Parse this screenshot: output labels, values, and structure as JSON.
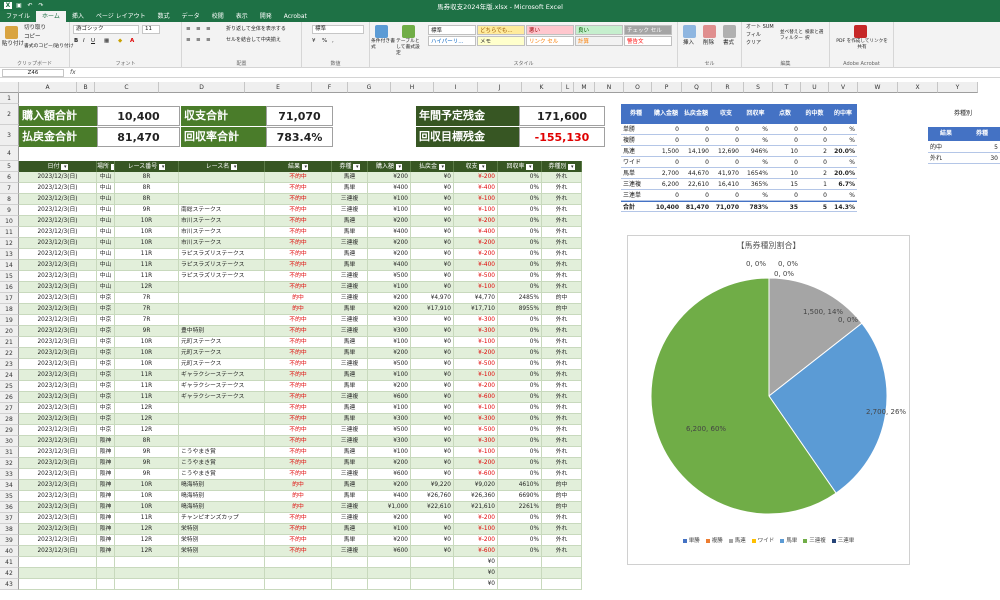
{
  "app": {
    "title": "馬券収支2024年版.xlsx - Microsoft Excel"
  },
  "tabs": [
    "ファイル",
    "ホーム",
    "挿入",
    "ページ レイアウト",
    "数式",
    "データ",
    "校閲",
    "表示",
    "開発",
    "Acrobat"
  ],
  "ribbon": {
    "clipboard": {
      "label": "クリップボード",
      "paste": "貼り付け",
      "cut": "切り取り",
      "copy": "コピー",
      "format_painter": "書式のコピー/貼り付け"
    },
    "font": {
      "label": "フォント",
      "name": "游ゴシック",
      "size": "11"
    },
    "alignment": {
      "label": "配置",
      "wrap": "折り返して全体を表示する",
      "merge": "セルを結合して中央揃え"
    },
    "number": {
      "label": "数値",
      "format": "標準"
    },
    "styles": {
      "label": "スタイル",
      "conditional": "条件付き書式",
      "table": "テーブルとして書式設定",
      "cells": [
        {
          "text": "標準",
          "bg": "#ffffff",
          "fg": "#222222"
        },
        {
          "text": "どちらでも...",
          "bg": "#ffeb9c",
          "fg": "#9c5700"
        },
        {
          "text": "悪い",
          "bg": "#ffc7ce",
          "fg": "#9c0006"
        },
        {
          "text": "良い",
          "bg": "#c6efce",
          "fg": "#006100"
        },
        {
          "text": "チェック セル",
          "bg": "#a5a5a5",
          "fg": "#ffffff"
        },
        {
          "text": "ハイパーリ...",
          "bg": "#ffffff",
          "fg": "#0563c1"
        },
        {
          "text": "メモ",
          "bg": "#ffffcc",
          "fg": "#222222"
        },
        {
          "text": "リンク セル",
          "bg": "#ffffff",
          "fg": "#fa7d00"
        },
        {
          "text": "計算",
          "bg": "#f2f2f2",
          "fg": "#fa7d00"
        },
        {
          "text": "警告文",
          "bg": "#ffffff",
          "fg": "#ff0000"
        }
      ]
    },
    "cells": {
      "label": "セル",
      "insert": "挿入",
      "delete": "削除",
      "format": "書式"
    },
    "editing": {
      "label": "編集",
      "autosum": "オート SUM",
      "fill": "フィル",
      "clear": "クリア",
      "sort": "並べ替えとフィルター",
      "find": "検索と選択"
    },
    "acrobat": {
      "label": "Adobe Acrobat",
      "pdf": "PDF を作成してリンクを共有"
    }
  },
  "formula_bar": {
    "name_box": "Z46",
    "fx": "fx"
  },
  "columns": [
    "A",
    "B",
    "C",
    "D",
    "E",
    "F",
    "G",
    "H",
    "I",
    "J",
    "K",
    "L",
    "M",
    "N",
    "O",
    "P",
    "Q",
    "R",
    "S",
    "T",
    "U",
    "V",
    "W",
    "X",
    "Y"
  ],
  "rows": [
    "1",
    "2",
    "3",
    "4",
    "5",
    "6",
    "7",
    "8",
    "9",
    "10",
    "11",
    "12",
    "13",
    "14",
    "15",
    "16",
    "17",
    "18",
    "19",
    "20",
    "21",
    "22",
    "23",
    "24",
    "25",
    "26",
    "27",
    "28",
    "29",
    "30",
    "31",
    "32",
    "33",
    "34",
    "35",
    "36",
    "37",
    "38",
    "39",
    "40",
    "41",
    "42",
    "43"
  ],
  "summary": {
    "purchase_label": "購入額合計",
    "purchase_value": "10,400",
    "balance_label": "収支合計",
    "balance_value": "71,070",
    "payout_label": "払戻金合計",
    "payout_value": "81,470",
    "return_label": "回収率合計",
    "return_value": "783.4%",
    "annual_label": "年間予定残金",
    "annual_value": "171,600",
    "target_label": "回収目標残金",
    "target_value": "-155,130"
  },
  "table": {
    "headers": [
      "日付",
      "場所",
      "レース番号",
      "レース名",
      "結果",
      "券種",
      "購入額",
      "払戻金",
      "収支",
      "回収率",
      "券種別"
    ],
    "rows": [
      [
        "2023/12/3(日)",
        "中山",
        "8R",
        "",
        "不的中",
        "馬連",
        "¥200",
        "¥0",
        "¥-200",
        "0%",
        "外れ"
      ],
      [
        "2023/12/3(日)",
        "中山",
        "8R",
        "",
        "不的中",
        "馬単",
        "¥400",
        "¥0",
        "¥-400",
        "0%",
        "外れ"
      ],
      [
        "2023/12/3(日)",
        "中山",
        "8R",
        "",
        "不的中",
        "三連複",
        "¥100",
        "¥0",
        "¥-100",
        "0%",
        "外れ"
      ],
      [
        "2023/12/3(日)",
        "中山",
        "9R",
        "南総ステークス",
        "不的中",
        "三連複",
        "¥100",
        "¥0",
        "¥-100",
        "0%",
        "外れ"
      ],
      [
        "2023/12/3(日)",
        "中山",
        "10R",
        "市川ステークス",
        "不的中",
        "馬連",
        "¥200",
        "¥0",
        "¥-200",
        "0%",
        "外れ"
      ],
      [
        "2023/12/3(日)",
        "中山",
        "10R",
        "市川ステークス",
        "不的中",
        "馬単",
        "¥400",
        "¥0",
        "¥-400",
        "0%",
        "外れ"
      ],
      [
        "2023/12/3(日)",
        "中山",
        "10R",
        "市川ステークス",
        "不的中",
        "三連複",
        "¥200",
        "¥0",
        "¥-200",
        "0%",
        "外れ"
      ],
      [
        "2023/12/3(日)",
        "中山",
        "11R",
        "ラピスラズリステークス",
        "不的中",
        "馬連",
        "¥200",
        "¥0",
        "¥-200",
        "0%",
        "外れ"
      ],
      [
        "2023/12/3(日)",
        "中山",
        "11R",
        "ラピスラズリステークス",
        "不的中",
        "馬単",
        "¥400",
        "¥0",
        "¥-400",
        "0%",
        "外れ"
      ],
      [
        "2023/12/3(日)",
        "中山",
        "11R",
        "ラピスラズリステークス",
        "不的中",
        "三連複",
        "¥500",
        "¥0",
        "¥-500",
        "0%",
        "外れ"
      ],
      [
        "2023/12/3(日)",
        "中山",
        "12R",
        "",
        "不的中",
        "三連複",
        "¥100",
        "¥0",
        "¥-100",
        "0%",
        "外れ"
      ],
      [
        "2023/12/3(日)",
        "中京",
        "7R",
        "",
        "的中",
        "三連複",
        "¥200",
        "¥4,970",
        "¥4,770",
        "2485%",
        "的中"
      ],
      [
        "2023/12/3(日)",
        "中京",
        "7R",
        "",
        "的中",
        "馬単",
        "¥200",
        "¥17,910",
        "¥17,710",
        "8955%",
        "的中"
      ],
      [
        "2023/12/3(日)",
        "中京",
        "7R",
        "",
        "不的中",
        "三連複",
        "¥300",
        "¥0",
        "¥-300",
        "0%",
        "外れ"
      ],
      [
        "2023/12/3(日)",
        "中京",
        "9R",
        "豊中特別",
        "不的中",
        "三連複",
        "¥300",
        "¥0",
        "¥-300",
        "0%",
        "外れ"
      ],
      [
        "2023/12/3(日)",
        "中京",
        "10R",
        "元町ステークス",
        "不的中",
        "馬連",
        "¥100",
        "¥0",
        "¥-100",
        "0%",
        "外れ"
      ],
      [
        "2023/12/3(日)",
        "中京",
        "10R",
        "元町ステークス",
        "不的中",
        "馬単",
        "¥200",
        "¥0",
        "¥-200",
        "0%",
        "外れ"
      ],
      [
        "2023/12/3(日)",
        "中京",
        "10R",
        "元町ステークス",
        "不的中",
        "三連複",
        "¥500",
        "¥0",
        "¥-500",
        "0%",
        "外れ"
      ],
      [
        "2023/12/3(日)",
        "中京",
        "11R",
        "ギャラクシーステークス",
        "不的中",
        "馬連",
        "¥100",
        "¥0",
        "¥-100",
        "0%",
        "外れ"
      ],
      [
        "2023/12/3(日)",
        "中京",
        "11R",
        "ギャラクシーステークス",
        "不的中",
        "馬単",
        "¥200",
        "¥0",
        "¥-200",
        "0%",
        "外れ"
      ],
      [
        "2023/12/3(日)",
        "中京",
        "11R",
        "ギャラクシーステークス",
        "不的中",
        "三連複",
        "¥600",
        "¥0",
        "¥-600",
        "0%",
        "外れ"
      ],
      [
        "2023/12/3(日)",
        "中京",
        "12R",
        "",
        "不的中",
        "馬連",
        "¥100",
        "¥0",
        "¥-100",
        "0%",
        "外れ"
      ],
      [
        "2023/12/3(日)",
        "中京",
        "12R",
        "",
        "不的中",
        "馬単",
        "¥300",
        "¥0",
        "¥-300",
        "0%",
        "外れ"
      ],
      [
        "2023/12/3(日)",
        "中京",
        "12R",
        "",
        "不的中",
        "三連複",
        "¥500",
        "¥0",
        "¥-500",
        "0%",
        "外れ"
      ],
      [
        "2023/12/3(日)",
        "阪神",
        "8R",
        "",
        "不的中",
        "三連複",
        "¥300",
        "¥0",
        "¥-300",
        "0%",
        "外れ"
      ],
      [
        "2023/12/3(日)",
        "阪神",
        "9R",
        "こうやまき賞",
        "不的中",
        "馬連",
        "¥100",
        "¥0",
        "¥-100",
        "0%",
        "外れ"
      ],
      [
        "2023/12/3(日)",
        "阪神",
        "9R",
        "こうやまき賞",
        "不的中",
        "馬単",
        "¥200",
        "¥0",
        "¥-200",
        "0%",
        "外れ"
      ],
      [
        "2023/12/3(日)",
        "阪神",
        "9R",
        "こうやまき賞",
        "不的中",
        "三連複",
        "¥600",
        "¥0",
        "¥-600",
        "0%",
        "外れ"
      ],
      [
        "2023/12/3(日)",
        "阪神",
        "10R",
        "鳴海特別",
        "的中",
        "馬連",
        "¥200",
        "¥9,220",
        "¥9,020",
        "4610%",
        "的中"
      ],
      [
        "2023/12/3(日)",
        "阪神",
        "10R",
        "鳴海特別",
        "的中",
        "馬単",
        "¥400",
        "¥26,760",
        "¥26,360",
        "6690%",
        "的中"
      ],
      [
        "2023/12/3(日)",
        "阪神",
        "10R",
        "鳴海特別",
        "的中",
        "三連複",
        "¥1,000",
        "¥22,610",
        "¥21,610",
        "2261%",
        "的中"
      ],
      [
        "2023/12/3(日)",
        "阪神",
        "11R",
        "チャンピオンズカップ",
        "不的中",
        "三連複",
        "¥200",
        "¥0",
        "¥-200",
        "0%",
        "外れ"
      ],
      [
        "2023/12/3(日)",
        "阪神",
        "12R",
        "栄特別",
        "不的中",
        "馬連",
        "¥100",
        "¥0",
        "¥-100",
        "0%",
        "外れ"
      ],
      [
        "2023/12/3(日)",
        "阪神",
        "12R",
        "栄特別",
        "不的中",
        "馬単",
        "¥200",
        "¥0",
        "¥-200",
        "0%",
        "外れ"
      ],
      [
        "2023/12/3(日)",
        "阪神",
        "12R",
        "栄特別",
        "不的中",
        "三連複",
        "¥600",
        "¥0",
        "¥-600",
        "0%",
        "外れ"
      ],
      [
        "",
        "",
        "",
        "",
        "",
        "",
        "",
        "",
        "¥0",
        "",
        ""
      ],
      [
        "",
        "",
        "",
        "",
        "",
        "",
        "",
        "",
        "¥0",
        "",
        ""
      ],
      [
        "",
        "",
        "",
        "",
        "",
        "",
        "",
        "",
        "¥0",
        "",
        ""
      ]
    ]
  },
  "stats": {
    "headers": [
      "券種",
      "購入金額",
      "払戻金額",
      "収支",
      "回収率",
      "点数",
      "的中数",
      "的中率"
    ],
    "rows": [
      [
        "単勝",
        "0",
        "0",
        "0",
        "%",
        "0",
        "0",
        "%"
      ],
      [
        "複勝",
        "0",
        "0",
        "0",
        "%",
        "0",
        "0",
        "%"
      ],
      [
        "馬連",
        "1,500",
        "14,190",
        "12,690",
        "946%",
        "10",
        "2",
        "20.0%"
      ],
      [
        "ワイド",
        "0",
        "0",
        "0",
        "%",
        "0",
        "0",
        "%"
      ],
      [
        "馬単",
        "2,700",
        "44,670",
        "41,970",
        "1654%",
        "10",
        "2",
        "20.0%"
      ],
      [
        "三連複",
        "6,200",
        "22,610",
        "16,410",
        "365%",
        "15",
        "1",
        "6.7%"
      ],
      [
        "三連単",
        "0",
        "0",
        "0",
        "%",
        "0",
        "0",
        "%"
      ],
      [
        "合計",
        "10,400",
        "81,470",
        "71,070",
        "783%",
        "35",
        "5",
        "14.3%"
      ]
    ]
  },
  "side": {
    "title": "券種別",
    "headers": [
      "結果",
      "券種"
    ],
    "rows": [
      [
        "的中",
        "5"
      ],
      [
        "外れ",
        "30"
      ]
    ]
  },
  "chart_data": {
    "type": "pie",
    "title": "【馬券種別割合】",
    "categories": [
      "単勝",
      "複勝",
      "馬連",
      "ワイド",
      "馬単",
      "三連複",
      "三連単"
    ],
    "values": [
      0,
      0,
      1500,
      0,
      2700,
      6200,
      0
    ],
    "percent_labels": [
      "0, 0%",
      "0, 0%",
      "1,500, 14%",
      "0, 0%",
      "2,700, 26%",
      "6,200, 60%",
      "0, 0%"
    ],
    "colors": [
      "#4472c4",
      "#ed7d31",
      "#a5a5a5",
      "#ffc000",
      "#5b9bd5",
      "#70ad47",
      "#264478"
    ],
    "legend": "bottom"
  }
}
